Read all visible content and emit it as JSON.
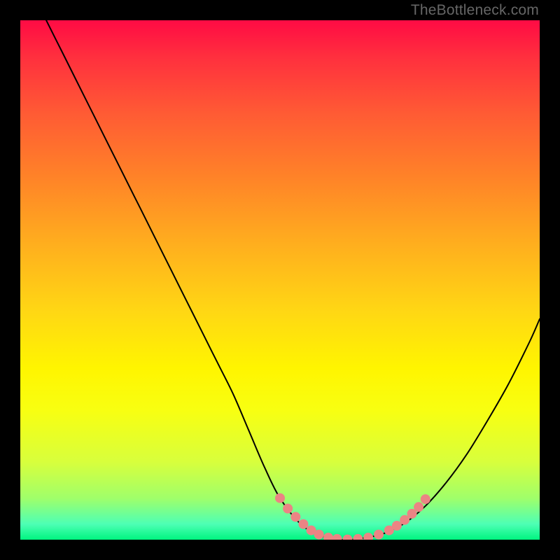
{
  "watermark": {
    "text": "TheBottleneck.com"
  },
  "colors": {
    "background": "#000000",
    "watermark": "#666666",
    "curve": "#000000",
    "dot": "#eb8484",
    "gradient_top": "#ff0b44",
    "gradient_bottom": "#00f480"
  },
  "chart_data": {
    "type": "line",
    "title": "",
    "xlabel": "",
    "ylabel": "",
    "xlim": [
      0,
      100
    ],
    "ylim": [
      0,
      100
    ],
    "x": [
      5,
      8,
      11,
      14,
      17,
      20,
      23,
      26,
      29,
      32,
      35,
      38,
      41,
      44,
      47,
      50,
      54,
      58,
      62,
      66,
      70,
      74,
      78,
      82,
      86,
      90,
      94,
      98,
      100
    ],
    "values": [
      100,
      94,
      88,
      82,
      76,
      70,
      64,
      58,
      52,
      46,
      40,
      34,
      28,
      21,
      14,
      8,
      3,
      0.7,
      0,
      0.3,
      1.2,
      3.2,
      6.5,
      11,
      16.5,
      23,
      30,
      38,
      42.5
    ],
    "highlight_points": [
      {
        "x": 50,
        "y": 8
      },
      {
        "x": 51.5,
        "y": 6
      },
      {
        "x": 53,
        "y": 4.4
      },
      {
        "x": 54.5,
        "y": 3
      },
      {
        "x": 56,
        "y": 1.8
      },
      {
        "x": 57.5,
        "y": 1
      },
      {
        "x": 59.3,
        "y": 0.4
      },
      {
        "x": 61,
        "y": 0.15
      },
      {
        "x": 63,
        "y": 0.05
      },
      {
        "x": 65,
        "y": 0.15
      },
      {
        "x": 67,
        "y": 0.4
      },
      {
        "x": 69,
        "y": 1
      },
      {
        "x": 71,
        "y": 1.8
      },
      {
        "x": 72.5,
        "y": 2.7
      },
      {
        "x": 74,
        "y": 3.8
      },
      {
        "x": 75.4,
        "y": 5
      },
      {
        "x": 76.7,
        "y": 6.3
      },
      {
        "x": 78,
        "y": 7.8
      }
    ]
  }
}
